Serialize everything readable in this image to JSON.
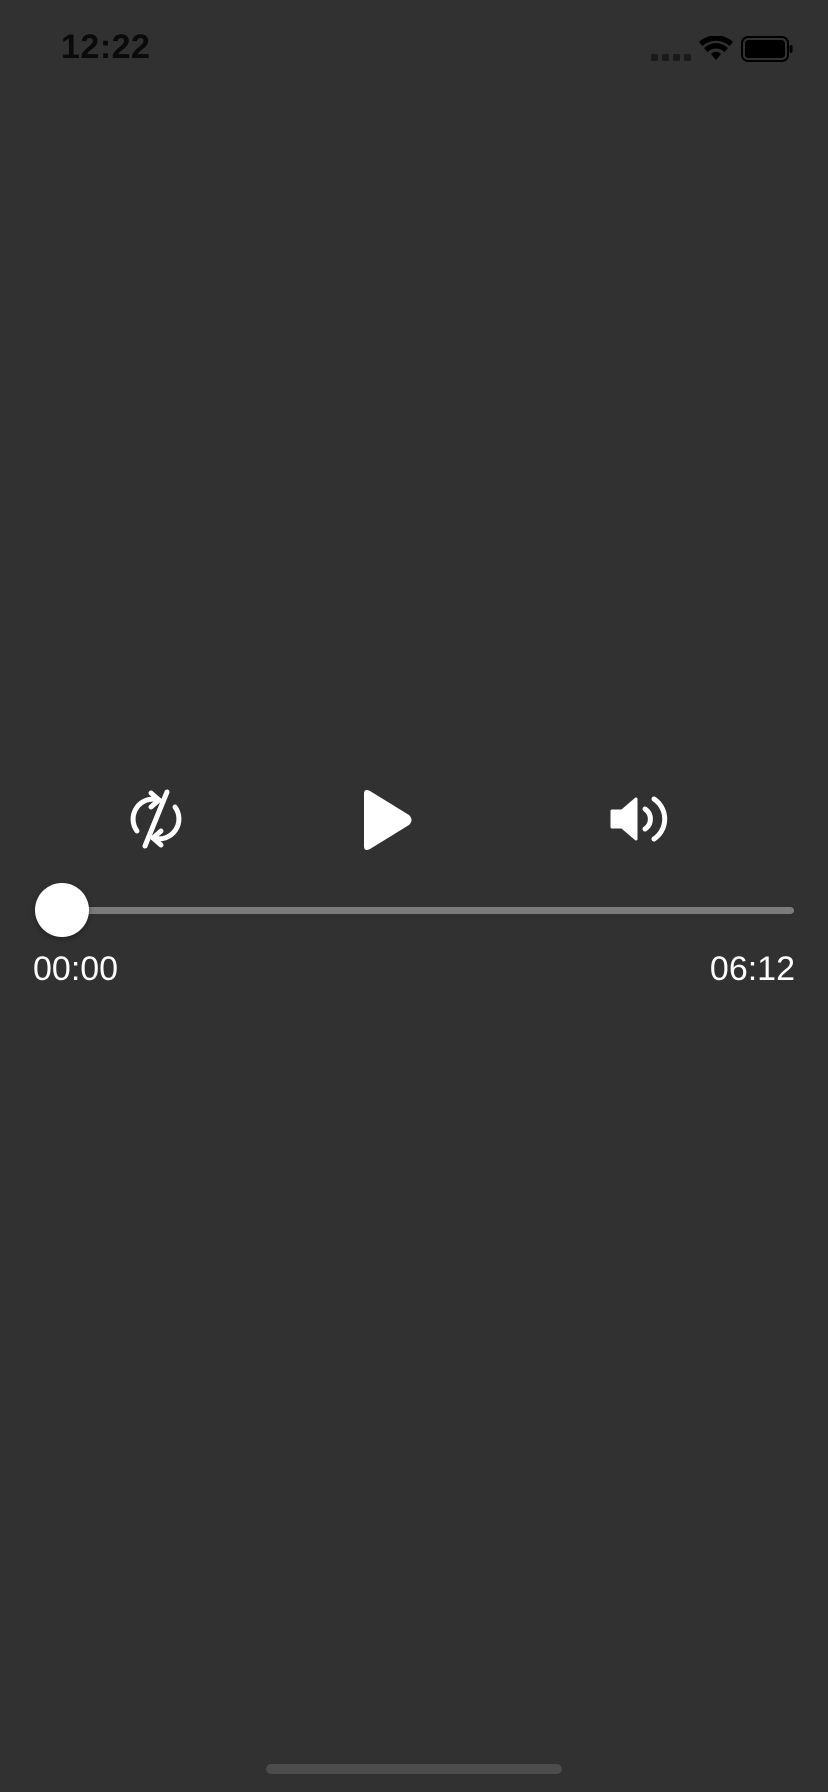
{
  "status_bar": {
    "time": "12:22",
    "icons": [
      "signal-icon",
      "wifi-icon",
      "battery-icon"
    ]
  },
  "controls": {
    "repeat_icon": "repeat-off-icon",
    "play_icon": "play-icon",
    "volume_icon": "speaker-volume-icon"
  },
  "player": {
    "elapsed": "00:00",
    "duration": "06:12",
    "progress": 0
  },
  "colors": {
    "background": "#313131",
    "foreground": "#ffffff",
    "track": "#7b7b7b"
  }
}
